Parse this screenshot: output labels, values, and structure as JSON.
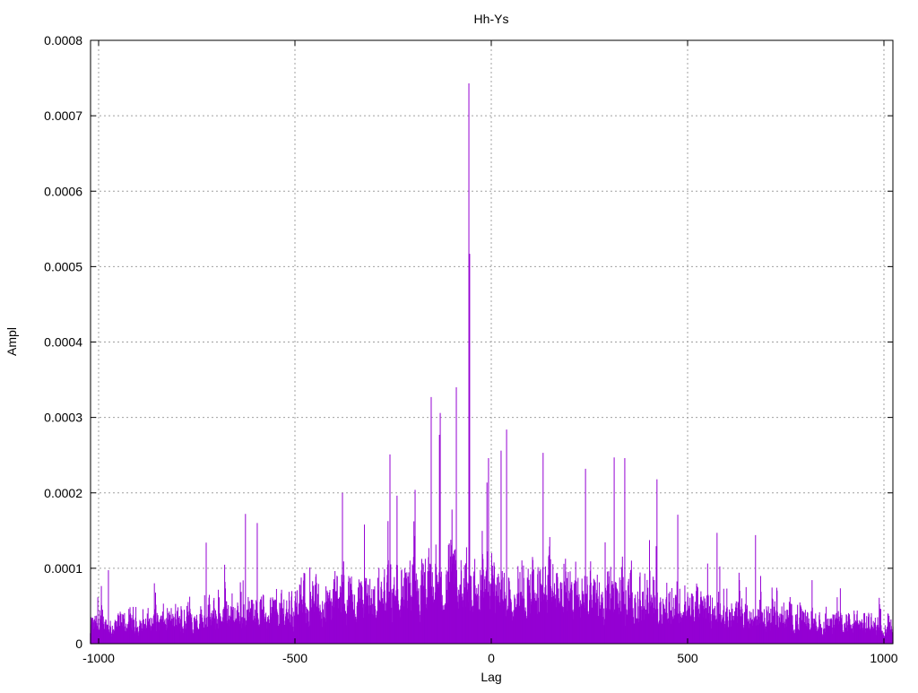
{
  "chart_data": {
    "type": "impulse",
    "title": "Hh-Ys",
    "xlabel": "Lag",
    "ylabel": "Ampl",
    "xlim": [
      -1021,
      1023
    ],
    "ylim": [
      0,
      0.0008
    ],
    "xticks": [
      -1000,
      -500,
      0,
      500,
      1000
    ],
    "xtick_labels": [
      "-1000",
      "-500",
      "0",
      "500",
      "1000"
    ],
    "yticks": [
      0,
      0.0001,
      0.0002,
      0.0003,
      0.0004,
      0.0005,
      0.0006,
      0.0007,
      0.0008
    ],
    "ytick_labels": [
      "0",
      "0.0001",
      "0.0002",
      "0.0003",
      "0.0004",
      "0.0005",
      "0.0006",
      "0.0007",
      "0.0008"
    ],
    "grid": true,
    "series_color": "#9400d3",
    "peaks": [
      [
        -57,
        0.000743
      ],
      [
        -55,
        0.000517
      ],
      [
        -89,
        0.00034
      ],
      [
        -153,
        0.000327
      ],
      [
        -130,
        0.000306
      ],
      [
        -132,
        0.000277
      ],
      [
        39,
        0.000284
      ],
      [
        25,
        0.000256
      ],
      [
        -7,
        0.000246
      ],
      [
        -258,
        0.000251
      ],
      [
        132,
        0.000253
      ],
      [
        313,
        0.000247
      ],
      [
        340,
        0.000246
      ],
      [
        240,
        0.000232
      ],
      [
        422,
        0.000218
      ],
      [
        -194,
        0.000204
      ],
      [
        -379,
        0.0002
      ],
      [
        -626,
        0.000172
      ],
      [
        575,
        0.000147
      ],
      [
        673,
        0.000144
      ],
      [
        -975,
        9.75e-05
      ],
      [
        -726,
        0.000134
      ],
      [
        -596,
        0.00016
      ],
      [
        475,
        0.000171
      ]
    ],
    "background": {
      "center_mean": 7e-05,
      "edge_mean": 2e-05,
      "spread_lags": 450
    }
  }
}
